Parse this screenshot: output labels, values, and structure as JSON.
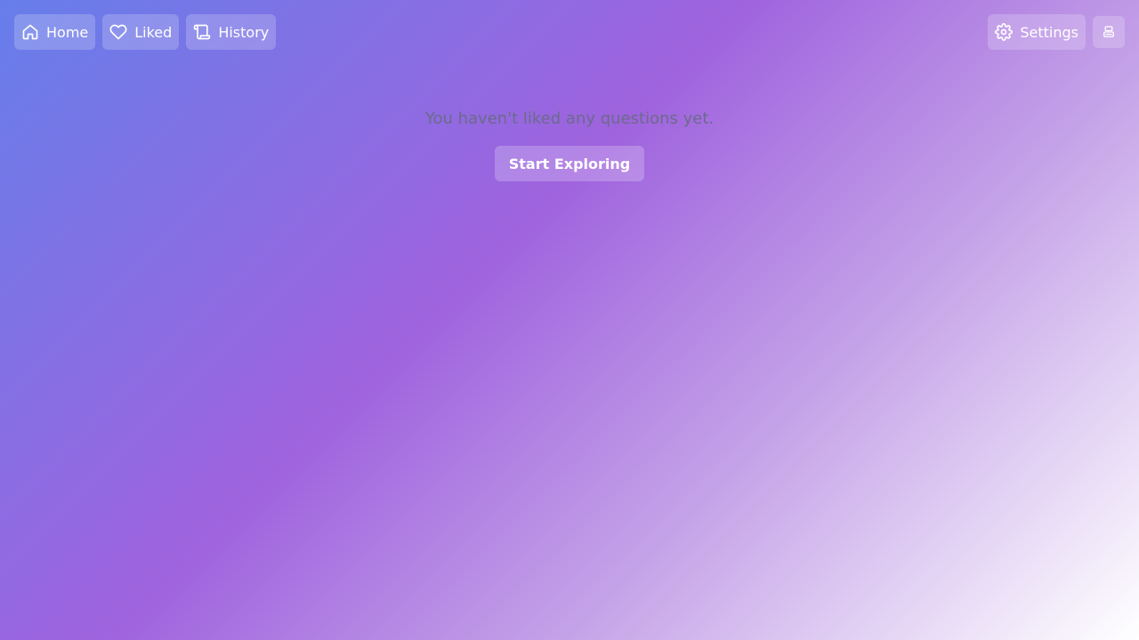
{
  "nav": {
    "home": {
      "label": "Home",
      "icon": "home-icon"
    },
    "liked": {
      "label": "Liked",
      "icon": "heart-icon"
    },
    "history": {
      "label": "History",
      "icon": "scroll-icon"
    },
    "settings": {
      "label": "Settings",
      "icon": "gear-icon"
    },
    "account": {
      "icon": "account-icon"
    }
  },
  "main": {
    "empty_message": "You haven't liked any questions yet.",
    "cta_label": "Start Exploring"
  },
  "colors": {
    "gradient_start": "#667eea",
    "gradient_mid": "#9f63de",
    "gradient_end": "#ffffff",
    "empty_text": "#6b6b8a"
  }
}
